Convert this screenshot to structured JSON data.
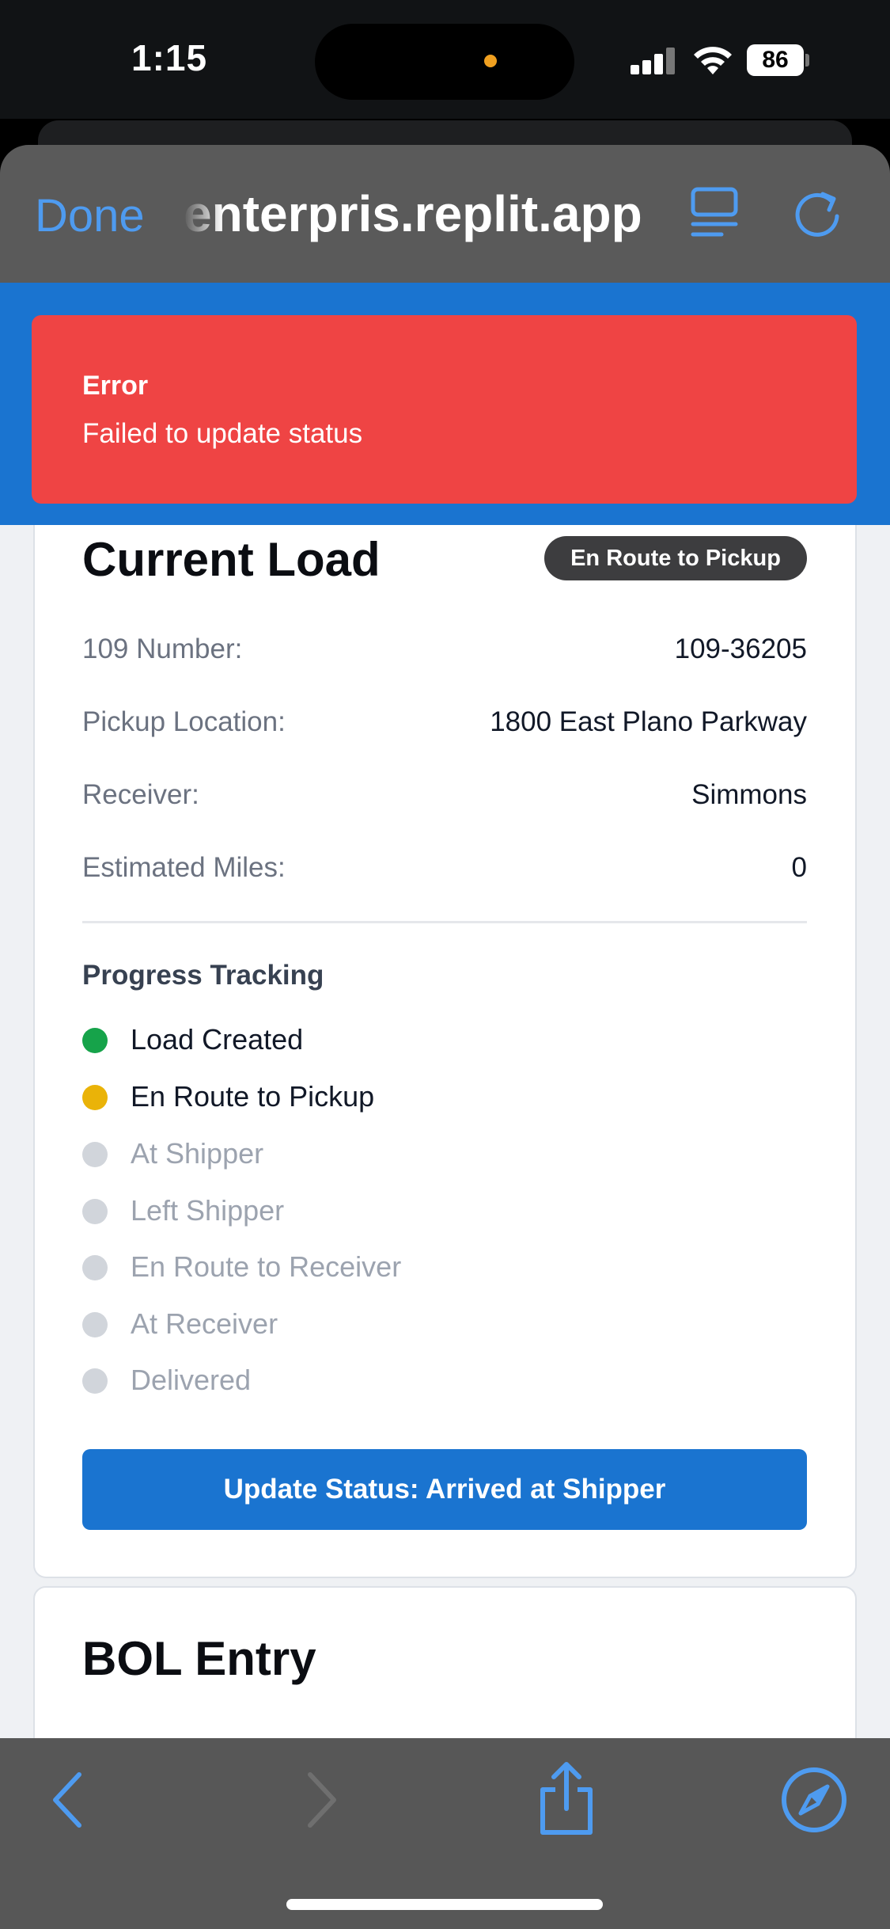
{
  "status_bar": {
    "time": "1:15",
    "battery": "86",
    "camera_dot_color": "#f0a020"
  },
  "browser": {
    "done_label": "Done",
    "url": "enterpris.replit.app",
    "accent_color": "#4e9bf0",
    "icons": [
      "reader-icon",
      "reload-icon",
      "back-icon",
      "forward-icon",
      "share-icon",
      "compass-icon"
    ]
  },
  "toast": {
    "title": "Error",
    "message": "Failed to update status",
    "color": "#ef4444"
  },
  "current_load": {
    "title": "Current Load",
    "status_badge": "En Route to Pickup",
    "fields": [
      {
        "label": "109 Number:",
        "value": "109-36205"
      },
      {
        "label": "Pickup Location:",
        "value": "1800 East Plano Parkway"
      },
      {
        "label": "Receiver:",
        "value": "Simmons"
      },
      {
        "label": "Estimated Miles:",
        "value": "0"
      }
    ],
    "progress_title": "Progress Tracking",
    "steps": [
      {
        "label": "Load Created",
        "state": "done",
        "color": "#16a34a"
      },
      {
        "label": "En Route to Pickup",
        "state": "current",
        "color": "#eab308"
      },
      {
        "label": "At Shipper",
        "state": "pending",
        "color": "#d1d5db"
      },
      {
        "label": "Left Shipper",
        "state": "pending",
        "color": "#d1d5db"
      },
      {
        "label": "En Route to Receiver",
        "state": "pending",
        "color": "#d1d5db"
      },
      {
        "label": "At Receiver",
        "state": "pending",
        "color": "#d1d5db"
      },
      {
        "label": "Delivered",
        "state": "pending",
        "color": "#d1d5db"
      }
    ],
    "update_button": "Update Status: Arrived at Shipper"
  },
  "bol": {
    "title": "BOL Entry"
  }
}
